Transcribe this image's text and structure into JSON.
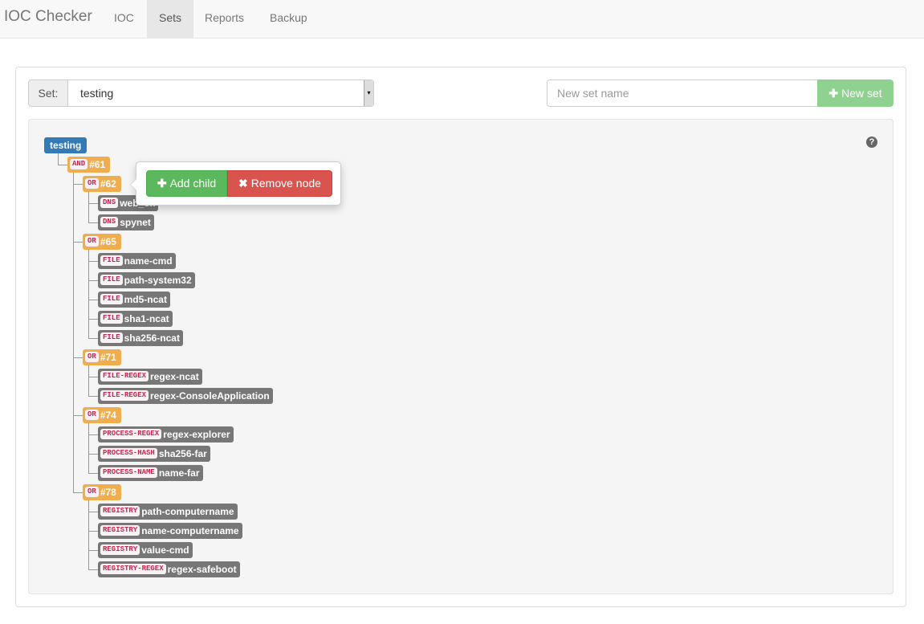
{
  "navbar": {
    "brand": "IOC Checker",
    "links": [
      {
        "label": "IOC",
        "active": false
      },
      {
        "label": "Sets",
        "active": true
      },
      {
        "label": "Reports",
        "active": false
      },
      {
        "label": "Backup",
        "active": false
      }
    ]
  },
  "set_selector": {
    "label": "Set:",
    "selected": "testing"
  },
  "new_set": {
    "placeholder": "New set name",
    "button_label": "New set",
    "button_icon": "plus-icon"
  },
  "help_icon": "question-circle-icon",
  "popover": {
    "add_child_label": "Add child",
    "remove_node_label": "Remove node"
  },
  "tree": {
    "root": "testing",
    "and_node": {
      "op": "AND",
      "id": "#61"
    },
    "groups": [
      {
        "op": "OR",
        "id": "#62",
        "items": [
          {
            "type": "DNS",
            "value": "web_ok"
          },
          {
            "type": "DNS",
            "value": "spynet"
          }
        ]
      },
      {
        "op": "OR",
        "id": "#65",
        "items": [
          {
            "type": "FILE",
            "value": "name-cmd"
          },
          {
            "type": "FILE",
            "value": "path-system32"
          },
          {
            "type": "FILE",
            "value": "md5-ncat"
          },
          {
            "type": "FILE",
            "value": "sha1-ncat"
          },
          {
            "type": "FILE",
            "value": "sha256-ncat"
          }
        ]
      },
      {
        "op": "OR",
        "id": "#71",
        "items": [
          {
            "type": "FILE-REGEX",
            "value": "regex-ncat"
          },
          {
            "type": "FILE-REGEX",
            "value": "regex-ConsoleApplication"
          }
        ]
      },
      {
        "op": "OR",
        "id": "#74",
        "items": [
          {
            "type": "PROCESS-REGEX",
            "value": "regex-explorer"
          },
          {
            "type": "PROCESS-HASH",
            "value": "sha256-far"
          },
          {
            "type": "PROCESS-NAME",
            "value": "name-far"
          }
        ]
      },
      {
        "op": "OR",
        "id": "#78",
        "items": [
          {
            "type": "REGISTRY",
            "value": "path-computername"
          },
          {
            "type": "REGISTRY",
            "value": "name-computername"
          },
          {
            "type": "REGISTRY",
            "value": "value-cmd"
          },
          {
            "type": "REGISTRY-REGEX",
            "value": "regex-safeboot"
          }
        ]
      }
    ]
  }
}
